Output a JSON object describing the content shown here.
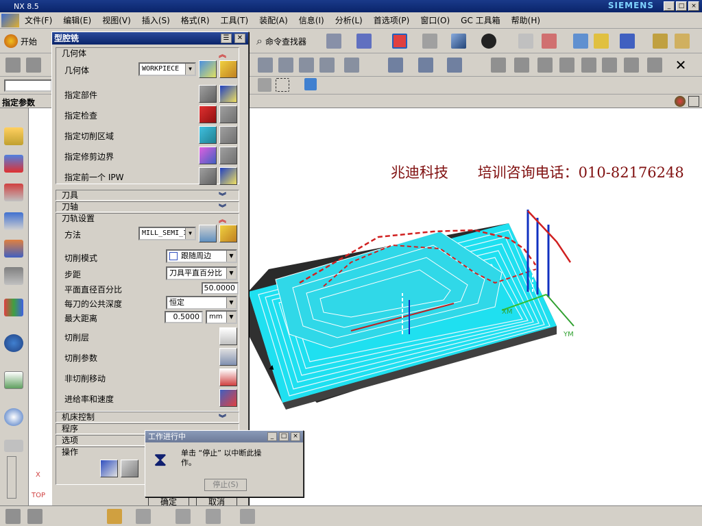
{
  "window": {
    "title": "NX 8.5",
    "brand": "SIEMENS"
  },
  "menu": [
    "文件(F)",
    "编辑(E)",
    "视图(V)",
    "插入(S)",
    "格式(R)",
    "工具(T)",
    "装配(A)",
    "信息(I)",
    "分析(L)",
    "首选项(P)",
    "窗口(O)",
    "GC 工具箱",
    "帮助(H)"
  ],
  "toolbar": {
    "start_label": "开始",
    "command_finder": "命令查找器"
  },
  "selection_bar": {
    "label": "指定参数"
  },
  "dialog": {
    "title": "型腔铣",
    "geometry_section": "几何体",
    "geometry_label": "几何体",
    "geometry_value": "WORKPIECE",
    "specify_part": "指定部件",
    "specify_check": "指定检查",
    "specify_cut_area": "指定切削区域",
    "specify_trim": "指定修剪边界",
    "specify_ipw": "指定前一个 IPW",
    "tool_section": "刀具",
    "axis_section": "刀轴",
    "path_section": "刀轨设置",
    "method_label": "方法",
    "method_value": "MILL_SEMI_I",
    "cut_pattern_label": "切削模式",
    "cut_pattern_value": "跟随周边",
    "stepover_label": "步距",
    "stepover_value": "刀具平直百分比",
    "flat_pct_label": "平面直径百分比",
    "flat_pct_value": "50.0000",
    "depth_label": "每刀的公共深度",
    "depth_value": "恒定",
    "max_dist_label": "最大距离",
    "max_dist_value": "0.5000",
    "max_dist_unit": "mm",
    "cut_levels": "切削层",
    "cut_params": "切削参数",
    "non_cut": "非切削移动",
    "feeds": "进给率和速度",
    "machine_section": "机床控制",
    "program_section": "程序",
    "options_section": "选项",
    "actions_section": "操作",
    "ok_button": "确定",
    "cancel_button": "取消"
  },
  "progress": {
    "title": "工作进行中",
    "message": "单击 “停止” 以中断此操作。",
    "stop_button": "停止(S)"
  },
  "overlay": {
    "company": "兆迪科技",
    "phone": "培训咨询电话：010-82176248"
  },
  "viewport": {
    "axis_xm": "XM",
    "axis_ym": "YM",
    "view_label": "TOP",
    "axis_x": "X"
  }
}
